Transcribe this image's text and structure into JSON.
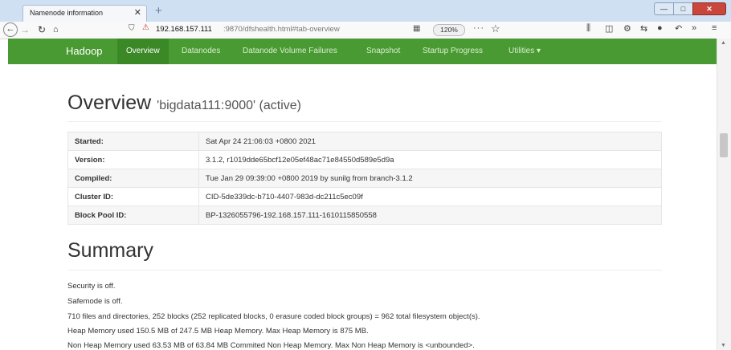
{
  "browser": {
    "tab_title": "Namenode information",
    "tab_close": "✕",
    "new_tab": "+",
    "url_host": "192.168.157.111",
    "url_path": ":9870/dfshealth.html#tab-overview",
    "zoom": "120%",
    "page_actions": "···",
    "window_controls": {
      "minimize": "—",
      "maximize": "□",
      "close": "✕"
    }
  },
  "nav": {
    "brand": "Hadoop",
    "items": [
      {
        "label": "Overview",
        "active": true
      },
      {
        "label": "Datanodes"
      },
      {
        "label": "Datanode Volume Failures"
      },
      {
        "label": "Snapshot"
      },
      {
        "label": "Startup Progress"
      },
      {
        "label": "Utilities ▾"
      }
    ]
  },
  "overview": {
    "title": "Overview",
    "subtitle": "'bigdata111:9000' (active)",
    "rows": [
      {
        "key": "Started:",
        "value": "Sat Apr 24 21:06:03 +0800 2021"
      },
      {
        "key": "Version:",
        "value": "3.1.2, r1019dde65bcf12e05ef48ac71e84550d589e5d9a"
      },
      {
        "key": "Compiled:",
        "value": "Tue Jan 29 09:39:00 +0800 2019 by sunilg from branch-3.1.2"
      },
      {
        "key": "Cluster ID:",
        "value": "CID-5de339dc-b710-4407-983d-dc211c5ec09f"
      },
      {
        "key": "Block Pool ID:",
        "value": "BP-1326055796-192.168.157.111-1610115850558"
      }
    ]
  },
  "summary": {
    "title": "Summary",
    "lines": [
      "Security is off.",
      "Safemode is off.",
      "710 files and directories, 252 blocks (252 replicated blocks, 0 erasure coded block groups) = 962 total filesystem object(s).",
      "Heap Memory used 150.5 MB of 247.5 MB Heap Memory. Max Heap Memory is 875 MB.",
      "Non Heap Memory used 63.53 MB of 63.84 MB Commited Non Heap Memory. Max Non Heap Memory is <unbounded>."
    ]
  },
  "colors": {
    "navbar": "#4a9a33",
    "navbar_active": "#3b8827"
  }
}
